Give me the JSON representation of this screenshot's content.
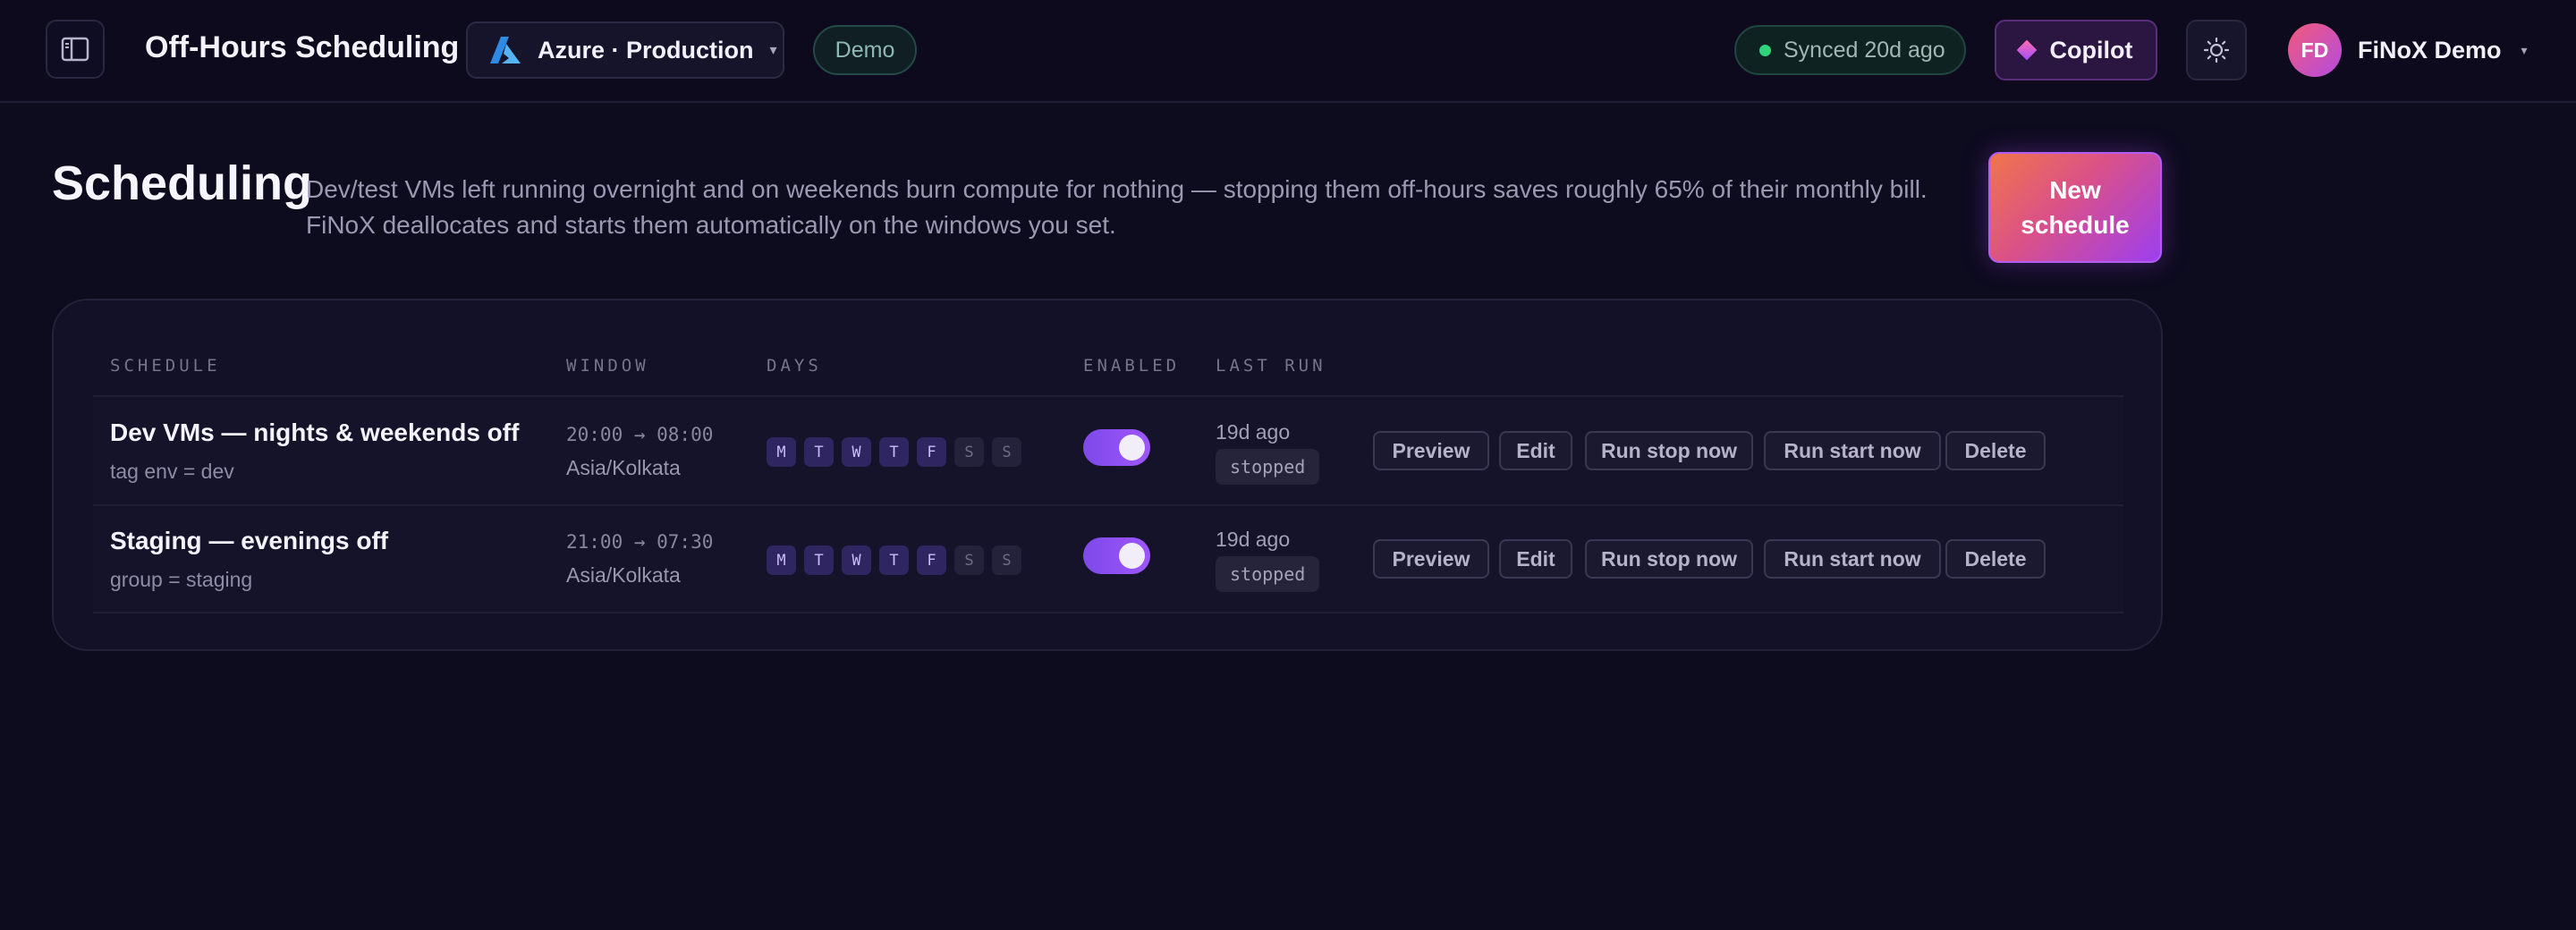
{
  "header": {
    "title": "Off-Hours Scheduling",
    "environment": "Azure · Production",
    "demo_badge": "Demo",
    "sync_status": "Synced 20d ago",
    "copilot_label": "Copilot",
    "user_initials": "FD",
    "user_name": "FiNoX Demo"
  },
  "page": {
    "heading": "Scheduling",
    "description_line1": "Dev/test VMs left running overnight and on weekends burn compute for nothing — stopping them off-hours saves roughly 65% of their monthly bill.",
    "description_line2": "FiNoX deallocates and starts them automatically on the windows you set.",
    "new_button_line1": "New",
    "new_button_line2": "schedule"
  },
  "table": {
    "columns": {
      "schedule": "SCHEDULE",
      "window": "WINDOW",
      "days": "DAYS",
      "enabled": "ENABLED",
      "last_run": "LAST RUN"
    },
    "actions": {
      "preview": "Preview",
      "edit": "Edit",
      "run_stop": "Run stop now",
      "run_start": "Run start now",
      "delete": "Delete"
    },
    "rows": [
      {
        "name": "Dev VMs — nights & weekends off",
        "scope": "tag env = dev",
        "window": "20:00 → 08:00",
        "timezone": "Asia/Kolkata",
        "days": [
          "M",
          "T",
          "W",
          "T",
          "F",
          "S",
          "S"
        ],
        "days_active": [
          true,
          true,
          true,
          true,
          true,
          false,
          false
        ],
        "enabled": true,
        "last_run": "19d ago",
        "status": "stopped"
      },
      {
        "name": "Staging — evenings off",
        "scope": "group = staging",
        "window": "21:00 → 07:30",
        "timezone": "Asia/Kolkata",
        "days": [
          "M",
          "T",
          "W",
          "T",
          "F",
          "S",
          "S"
        ],
        "days_active": [
          true,
          true,
          true,
          true,
          true,
          false,
          false
        ],
        "enabled": true,
        "last_run": "19d ago",
        "status": "stopped"
      }
    ]
  },
  "colors": {
    "background": "#0d0b1e",
    "accent": "#a055ff",
    "sync_dot": "#2fd37b"
  }
}
